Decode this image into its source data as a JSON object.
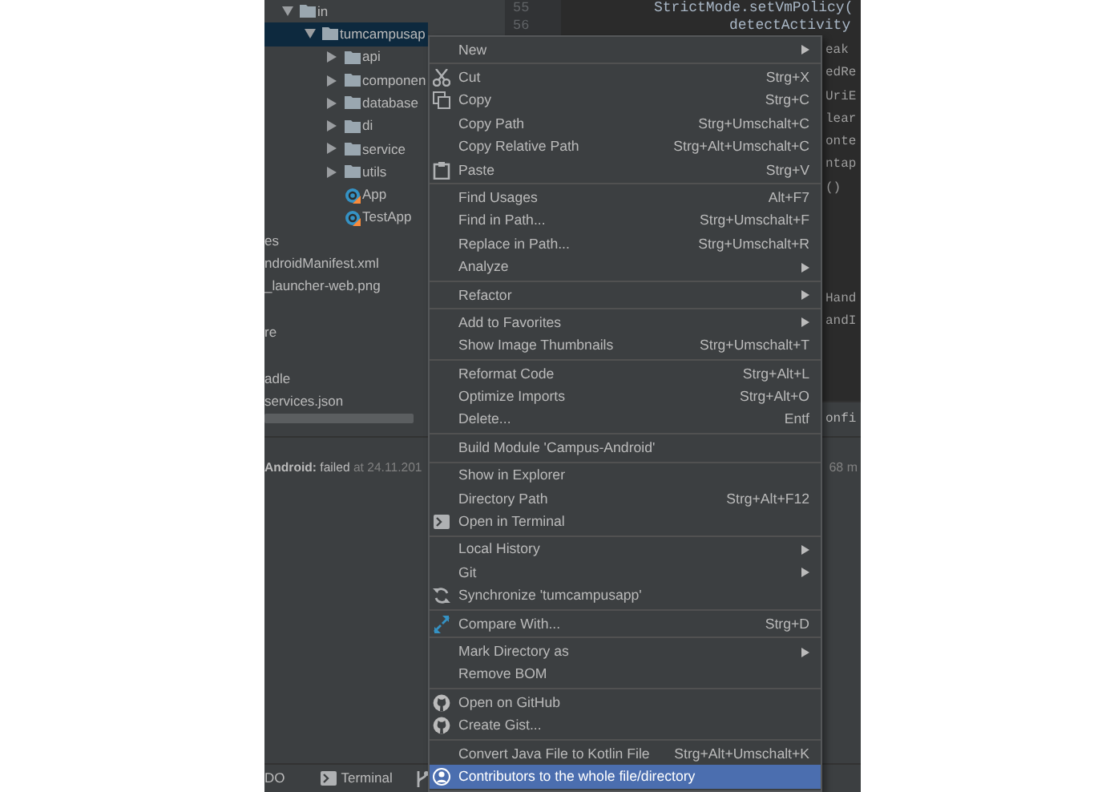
{
  "project_tree": {
    "items": [
      {
        "label": "in",
        "kind": "folder",
        "expanded": true,
        "selected": false,
        "children": [
          {
            "label": "tumcampusap",
            "kind": "folder",
            "expanded": true,
            "selected": true,
            "children": [
              {
                "label": "api",
                "kind": "folder",
                "expanded": false,
                "selected": false
              },
              {
                "label": "componen",
                "kind": "folder",
                "expanded": false,
                "selected": false
              },
              {
                "label": "database",
                "kind": "folder",
                "expanded": false,
                "selected": false
              },
              {
                "label": "di",
                "kind": "folder",
                "expanded": false,
                "selected": false
              },
              {
                "label": "service",
                "kind": "folder",
                "expanded": false,
                "selected": false
              },
              {
                "label": "utils",
                "kind": "folder",
                "expanded": false,
                "selected": false
              },
              {
                "label": "App",
                "kind": "class",
                "selected": false
              },
              {
                "label": "TestApp",
                "kind": "class",
                "selected": false
              }
            ]
          }
        ]
      }
    ],
    "clipped_items": [
      {
        "label": "es",
        "selected": false
      },
      {
        "label": "ndroidManifest.xml",
        "selected": false
      },
      {
        "label": "_launcher-web.png",
        "selected": false
      },
      {
        "label": "re",
        "selected": false
      },
      {
        "label": "adle",
        "selected": false
      },
      {
        "label": "services.json",
        "selected": false
      }
    ]
  },
  "editor": {
    "line_numbers": [
      "55",
      "56"
    ],
    "code_lines": [
      "StrictMode.setVmPolicy(",
      "detectActivity"
    ],
    "clipped_lines_upper": [
      "eak",
      "edRe",
      "UriE",
      "lear",
      "onte",
      "ntap",
      "()"
    ],
    "clipped_lines_lower": [
      "Hand",
      "andI"
    ],
    "header_fragment": "onfi"
  },
  "event_log": {
    "message": "**Android:** failed",
    "time": "at 24.11.201",
    "clipped_fragment": "68 m"
  },
  "tool_window_bar": [
    {
      "kind": "text",
      "label": "DO"
    },
    {
      "kind": "terminal",
      "label": "Terminal"
    },
    {
      "kind": "branch"
    }
  ],
  "context_menu": {
    "groups": [
      [
        {
          "label": "New",
          "submenu": true,
          "selected": false
        }
      ],
      [
        {
          "label": "Cut",
          "kind": "scissors",
          "shortcut": "Strg+X",
          "selected": false
        },
        {
          "label": "Copy",
          "kind": "copy",
          "shortcut": "Strg+C",
          "selected": false
        },
        {
          "label": "Copy Path",
          "shortcut": "Strg+Umschalt+C",
          "selected": false
        },
        {
          "label": "Copy Relative Path",
          "shortcut": "Strg+Alt+Umschalt+C",
          "selected": false
        },
        {
          "label": "Paste",
          "kind": "clipboard",
          "shortcut": "Strg+V",
          "selected": false
        }
      ],
      [
        {
          "label": "Find Usages",
          "shortcut": "Alt+F7",
          "selected": false
        },
        {
          "label": "Find in Path...",
          "shortcut": "Strg+Umschalt+F",
          "selected": false
        },
        {
          "label": "Replace in Path...",
          "shortcut": "Strg+Umschalt+R",
          "selected": false
        },
        {
          "label": "Analyze",
          "submenu": true,
          "selected": false
        }
      ],
      [
        {
          "label": "Refactor",
          "submenu": true,
          "selected": false
        }
      ],
      [
        {
          "label": "Add to Favorites",
          "submenu": true,
          "selected": false
        },
        {
          "label": "Show Image Thumbnails",
          "shortcut": "Strg+Umschalt+T",
          "selected": false
        }
      ],
      [
        {
          "label": "Reformat Code",
          "shortcut": "Strg+Alt+L",
          "selected": false
        },
        {
          "label": "Optimize Imports",
          "shortcut": "Strg+Alt+O",
          "selected": false
        },
        {
          "label": "Delete...",
          "shortcut": "Entf",
          "selected": false
        }
      ],
      [
        {
          "label": "Build Module 'Campus-Android'",
          "selected": false
        }
      ],
      [
        {
          "label": "Show in Explorer",
          "selected": false
        },
        {
          "label": "Directory Path",
          "shortcut": "Strg+Alt+F12",
          "selected": false
        },
        {
          "label": "Open in Terminal",
          "kind": "terminal",
          "selected": false
        }
      ],
      [
        {
          "label": "Local History",
          "submenu": true,
          "selected": false
        },
        {
          "label": "Git",
          "submenu": true,
          "selected": false
        },
        {
          "label": "Synchronize 'tumcampusapp'",
          "kind": "sync",
          "selected": false
        }
      ],
      [
        {
          "label": "Compare With...",
          "kind": "compare",
          "shortcut": "Strg+D",
          "selected": false
        }
      ],
      [
        {
          "label": "Mark Directory as",
          "submenu": true,
          "selected": false
        },
        {
          "label": "Remove BOM",
          "selected": false
        }
      ],
      [
        {
          "label": "Open on GitHub",
          "kind": "github",
          "selected": false
        },
        {
          "label": "Create Gist...",
          "kind": "github",
          "selected": false
        }
      ],
      [
        {
          "label": "Convert Java File to Kotlin File",
          "shortcut": "Strg+Alt+Umschalt+K",
          "selected": false
        },
        {
          "label": "Contributors to the whole file/directory",
          "kind": "person",
          "selected": true
        }
      ]
    ]
  }
}
